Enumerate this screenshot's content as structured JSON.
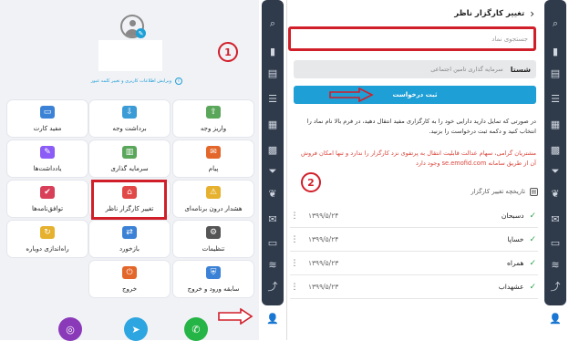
{
  "left": {
    "edit_profile_link": "ویرایش اطلاعات کاربری و تغییر کلمه عبور",
    "step_badge": "1",
    "tiles": [
      {
        "label": "مفید کارت",
        "icon": "card-icon"
      },
      {
        "label": "برداشت وجه",
        "icon": "withdraw-icon"
      },
      {
        "label": "واریز وجه",
        "icon": "deposit-icon"
      },
      {
        "label": "یادداشت‌ها",
        "icon": "notes-icon"
      },
      {
        "label": "سرمایه گذاری",
        "icon": "investment-icon"
      },
      {
        "label": "پیام",
        "icon": "message-icon"
      },
      {
        "label": "توافق‌نامه‌ها",
        "icon": "agreement-icon"
      },
      {
        "label": "تغییر کارگزار ناظر",
        "icon": "broker-change-icon"
      },
      {
        "label": "هشدار درون برنامه‌ای",
        "icon": "alarm-icon"
      },
      {
        "label": "راه‌اندازی دوباره",
        "icon": "restart-icon"
      },
      {
        "label": "بازخورد",
        "icon": "feedback-icon"
      },
      {
        "label": "تنظیمات",
        "icon": "settings-icon"
      },
      {
        "label": "خروج",
        "icon": "power-icon"
      },
      {
        "label": "سابقه ورود و خروج",
        "icon": "history-shield-icon"
      }
    ]
  },
  "right": {
    "title": "تغییر کارگزار ناظر",
    "search_placeholder": "جستجوی نماد",
    "symbol": "شستا",
    "symbol_desc": "سرمایه گذاری تامین اجتماعی",
    "submit_label": "ثبت درخواست",
    "info_text": "در صورتی که تمایل دارید دارایی خود را به کارگزاری مفید انتقال دهید، در فرم بالا نام نماد را انتخاب کنید و دکمه ثبت درخواست را بزنید.",
    "warning_text": "مشتریان گرامی، سهام عدالت قابلیت انتقال به پرتفوی نزد کارگزار را ندارد و تنها امکان فروش آن از طریق سامانه se.emofid.com وجود دارد",
    "history_title": "تاریخچه تغییر کارگزار",
    "step_badge": "2",
    "history": [
      {
        "name": "دسبحان",
        "date": "۱۳۹۹/۵/۲۴"
      },
      {
        "name": "خساپا",
        "date": "۱۳۹۹/۵/۲۴"
      },
      {
        "name": "همراه",
        "date": "۱۳۹۹/۵/۲۳"
      },
      {
        "name": "عشهداب",
        "date": "۱۳۹۹/۵/۲۳"
      }
    ]
  },
  "colors": {
    "accent_blue": "#1e9fd6",
    "annotation_red": "#d11f2a",
    "rail": "#2f3a4a",
    "warning_red": "#d9443a",
    "tile_icon_green": "#5aa65a"
  }
}
